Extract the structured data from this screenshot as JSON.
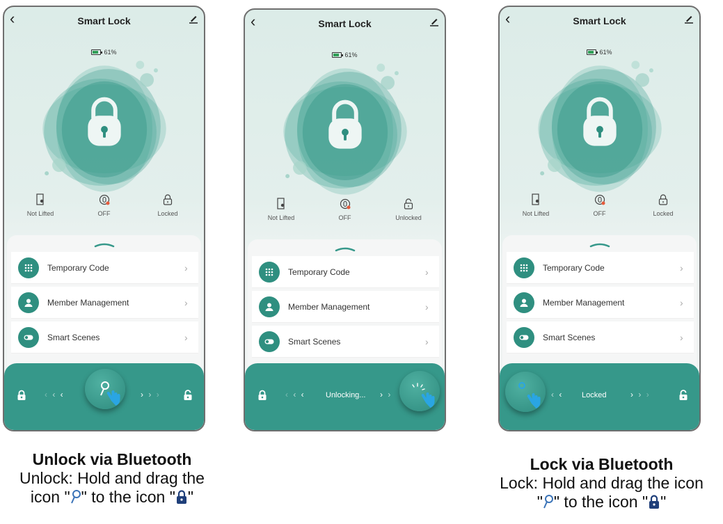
{
  "screens": [
    {
      "title": "Smart Lock",
      "battery": "61%",
      "status": [
        {
          "label": "Not Lifted",
          "icon": "door-sensor-icon"
        },
        {
          "label": "OFF",
          "icon": "anti-lock-icon"
        },
        {
          "label": "Locked",
          "icon": "padlock-icon"
        }
      ],
      "menu": [
        {
          "label": "Temporary Code",
          "icon": "keypad-icon"
        },
        {
          "label": "Member Management",
          "icon": "user-icon"
        },
        {
          "label": "Smart Scenes",
          "icon": "toggle-icon"
        }
      ],
      "bar_text": ""
    },
    {
      "title": "Smart Lock",
      "battery": "61%",
      "status": [
        {
          "label": "Not Lifted",
          "icon": "door-sensor-icon"
        },
        {
          "label": "OFF",
          "icon": "anti-lock-icon"
        },
        {
          "label": "Unlocked",
          "icon": "unlocked-padlock-icon"
        }
      ],
      "menu": [
        {
          "label": "Temporary Code",
          "icon": "keypad-icon"
        },
        {
          "label": "Member Management",
          "icon": "user-icon"
        },
        {
          "label": "Smart Scenes",
          "icon": "toggle-icon"
        }
      ],
      "bar_text": "Unlocking..."
    },
    {
      "title": "Smart Lock",
      "battery": "61%",
      "status": [
        {
          "label": "Not Lifted",
          "icon": "door-sensor-icon"
        },
        {
          "label": "OFF",
          "icon": "anti-lock-icon"
        },
        {
          "label": "Locked",
          "icon": "padlock-icon"
        }
      ],
      "menu": [
        {
          "label": "Temporary Code",
          "icon": "keypad-icon"
        },
        {
          "label": "Member Management",
          "icon": "user-icon"
        },
        {
          "label": "Smart Scenes",
          "icon": "toggle-icon"
        }
      ],
      "bar_text": "Locked"
    }
  ],
  "captions": {
    "unlock": {
      "title": "Unlock via Bluetooth",
      "line1": "Unlock: Hold and drag the",
      "line2_pre": "icon \"",
      "line2_mid": "\" to the icon \"",
      "line2_post": "\""
    },
    "lock": {
      "title": "Lock via Bluetooth",
      "line1": "Lock: Hold and drag the icon",
      "line2_pre": "\"",
      "line2_mid": "\" to the icon \"",
      "line2_post": "\""
    }
  },
  "colors": {
    "accent": "#36988a",
    "icon_bg": "#2f8f80",
    "battery": "#2e9e55",
    "caption_key_icon": "#3a73b8",
    "caption_lock_icon": "#1f3f7a"
  }
}
